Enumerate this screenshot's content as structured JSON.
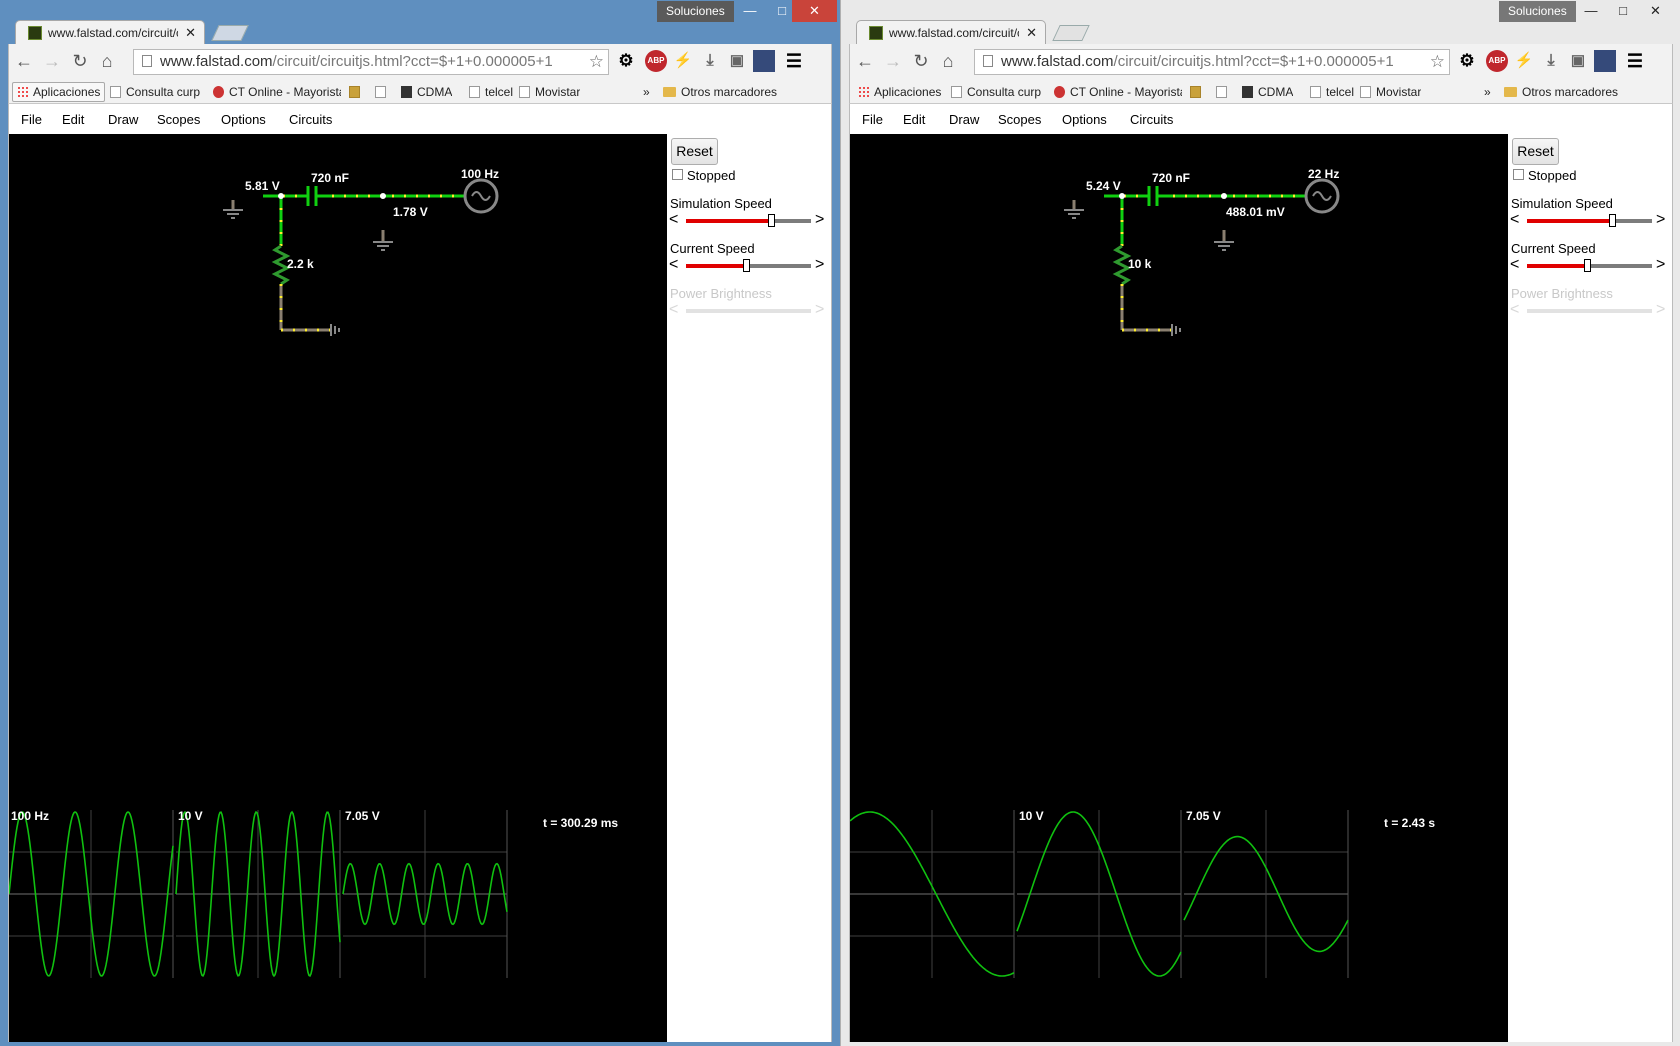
{
  "windows": [
    {
      "user_badge": "Soluciones",
      "tab_title": "www.falstad.com/circuit/c",
      "url_host": "www.falstad.com",
      "url_path": "/circuit/circuitjs.html?cct=$+1+0.000005+1",
      "bookmarks": {
        "apps": "Aplicaciones",
        "b1": "Consulta curp",
        "b2": "CT Online - Mayorista",
        "b4": "CDMA",
        "b5": "telcel",
        "b6": "Movistar",
        "more": "»",
        "other": "Otros marcadores"
      },
      "menu": [
        "File",
        "Edit",
        "Draw",
        "Scopes",
        "Options",
        "Circuits"
      ],
      "panel": {
        "reset": "Reset",
        "stopped": "Stopped",
        "sim_speed": "Simulation Speed",
        "sim_speed_level": 0.68,
        "current_speed": "Current Speed",
        "current_speed_level": 0.48,
        "power_brightness": "Power Brightness"
      },
      "circuit": {
        "node_voltage": "5.81 V",
        "cap_label": "720 nF",
        "freq_label": "100 Hz",
        "out_voltage": "1.78 V",
        "res_label": "2.2 k"
      },
      "scopes": {
        "labels": [
          "100 Hz",
          "10 V",
          "7.05 V"
        ],
        "time": "t = 300.29 ms",
        "cycles": [
          3.1,
          4.6,
          5.6
        ],
        "amps": [
          1.0,
          1.0,
          0.37
        ]
      }
    },
    {
      "user_badge": "Soluciones",
      "tab_title": "www.falstad.com/circuit/c",
      "url_host": "www.falstad.com",
      "url_path": "/circuit/circuitjs.html?cct=$+1+0.000005+1",
      "bookmarks": {
        "apps": "Aplicaciones",
        "b1": "Consulta curp",
        "b2": "CT Online - Mayorista",
        "b4": "CDMA",
        "b5": "telcel",
        "b6": "Movistar",
        "more": "»",
        "other": "Otros marcadores"
      },
      "menu": [
        "File",
        "Edit",
        "Draw",
        "Scopes",
        "Options",
        "Circuits"
      ],
      "panel": {
        "reset": "Reset",
        "stopped": "Stopped",
        "sim_speed": "Simulation Speed",
        "sim_speed_level": 0.68,
        "current_speed": "Current Speed",
        "current_speed_level": 0.48,
        "power_brightness": "Power Brightness"
      },
      "circuit": {
        "node_voltage": "5.24 V",
        "cap_label": "720 nF",
        "freq_label": "22 Hz",
        "out_voltage": "488.01 mV",
        "res_label": "10 k"
      },
      "scopes": {
        "labels": [
          "",
          "10 V",
          "7.05 V"
        ],
        "time": "t = 2.43 s",
        "cycles": [
          0.62,
          0.95,
          1.0
        ],
        "amps": [
          1.0,
          1.0,
          0.7
        ]
      }
    }
  ]
}
